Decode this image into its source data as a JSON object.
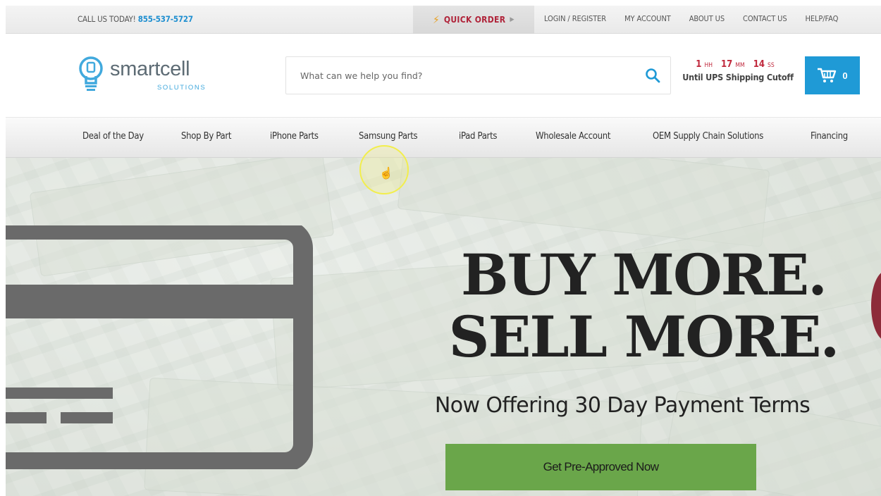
{
  "topbar": {
    "call_label": "CALL US TODAY!",
    "phone": "855-537-5727",
    "quick_order": "QUICK ORDER",
    "links": [
      "LOGIN / REGISTER",
      "MY ACCOUNT",
      "ABOUT US",
      "CONTACT US",
      "HELP/FAQ"
    ]
  },
  "logo": {
    "name": "smartcell",
    "sub": "SOLUTIONS",
    "icon": "smartcell-bulb-icon"
  },
  "search": {
    "placeholder": "What can we help you find?",
    "icon": "search-icon"
  },
  "countdown": {
    "hours": "1",
    "hours_unit": "HH",
    "minutes": "17",
    "minutes_unit": "MM",
    "seconds": "14",
    "seconds_unit": "SS",
    "caption": "Until UPS Shipping Cutoff"
  },
  "cart": {
    "count": "0",
    "icon": "shopping-cart-icon"
  },
  "nav": {
    "items": [
      "Deal of the Day",
      "Shop By Part",
      "iPhone Parts",
      "Samsung Parts",
      "iPad Parts",
      "Wholesale Account",
      "OEM Supply Chain Solutions",
      "Financing"
    ]
  },
  "hero": {
    "headline_1": "BUY MORE.",
    "headline_2": "SELL MORE.",
    "subline": "Now Offering 30 Day Payment Terms",
    "cta": "Get Pre-Approved Now",
    "background": "dollar-bills-background"
  },
  "colors": {
    "accent_blue": "#1f9ad6",
    "brand_red": "#c0283c",
    "cta_green": "#6aa64a",
    "card_gray": "#6a6a6a"
  }
}
